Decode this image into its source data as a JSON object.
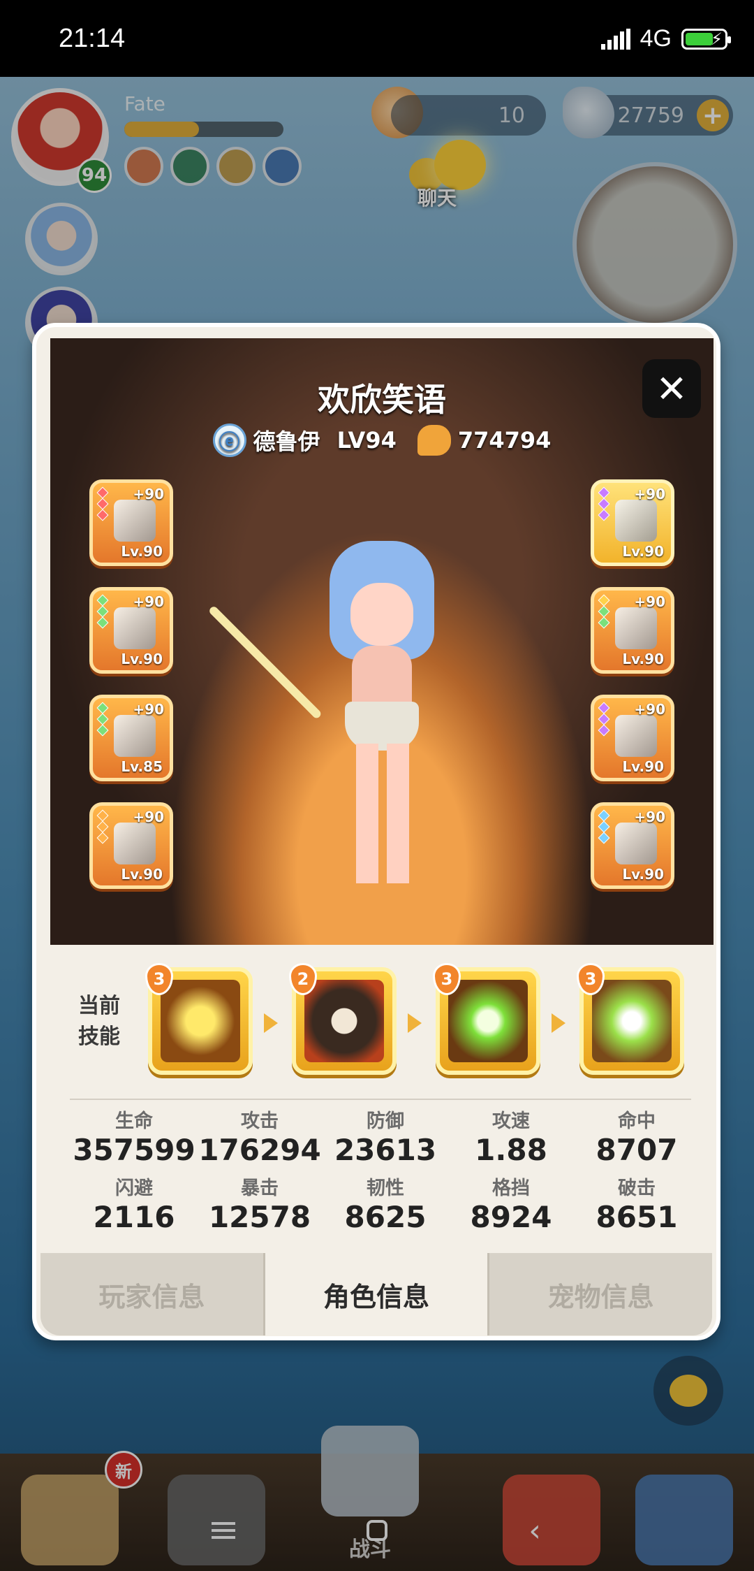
{
  "status_bar": {
    "time": "21:14",
    "network": "4G"
  },
  "hud": {
    "player_name": "Fate",
    "level": "94",
    "resource1_value": "10",
    "resource2_value": "27759",
    "chat_label": "聊天"
  },
  "dialog": {
    "character_name": "欢欣笑语",
    "class_name": "德鲁伊",
    "level_text": "LV94",
    "power": "774794",
    "close_symbol": "✕",
    "equipment_left": [
      {
        "plus": "+90",
        "level": "Lv.90"
      },
      {
        "plus": "+90",
        "level": "Lv.90"
      },
      {
        "plus": "+90",
        "level": "Lv.85"
      },
      {
        "plus": "+90",
        "level": "Lv.90"
      }
    ],
    "equipment_right": [
      {
        "plus": "+90",
        "level": "Lv.90"
      },
      {
        "plus": "+90",
        "level": "Lv.90"
      },
      {
        "plus": "+90",
        "level": "Lv.90"
      },
      {
        "plus": "+90",
        "level": "Lv.90"
      }
    ],
    "skills_label": "当前技能",
    "skills": [
      {
        "badge": "3",
        "icon": "shield-cross-icon"
      },
      {
        "badge": "2",
        "icon": "owl-icon"
      },
      {
        "badge": "3",
        "icon": "heal-cross-icon"
      },
      {
        "badge": "3",
        "icon": "totem-icon"
      }
    ],
    "stats": [
      {
        "label": "生命",
        "value": "357599"
      },
      {
        "label": "攻击",
        "value": "176294"
      },
      {
        "label": "防御",
        "value": "23613"
      },
      {
        "label": "攻速",
        "value": "1.88"
      },
      {
        "label": "命中",
        "value": "8707"
      },
      {
        "label": "闪避",
        "value": "2116"
      },
      {
        "label": "暴击",
        "value": "12578"
      },
      {
        "label": "韧性",
        "value": "8625"
      },
      {
        "label": "格挡",
        "value": "8924"
      },
      {
        "label": "破击",
        "value": "8651"
      }
    ],
    "tabs": [
      {
        "label": "玩家信息",
        "active": false
      },
      {
        "label": "角色信息",
        "active": true
      },
      {
        "label": "宠物信息",
        "active": false
      }
    ]
  },
  "bottom": {
    "new_badge": "新",
    "battle_label": "战斗"
  },
  "colors": {
    "accent_orange": "#e4772b",
    "skill_gold": "#ffd54a",
    "panel_bg": "#f3efe7"
  }
}
